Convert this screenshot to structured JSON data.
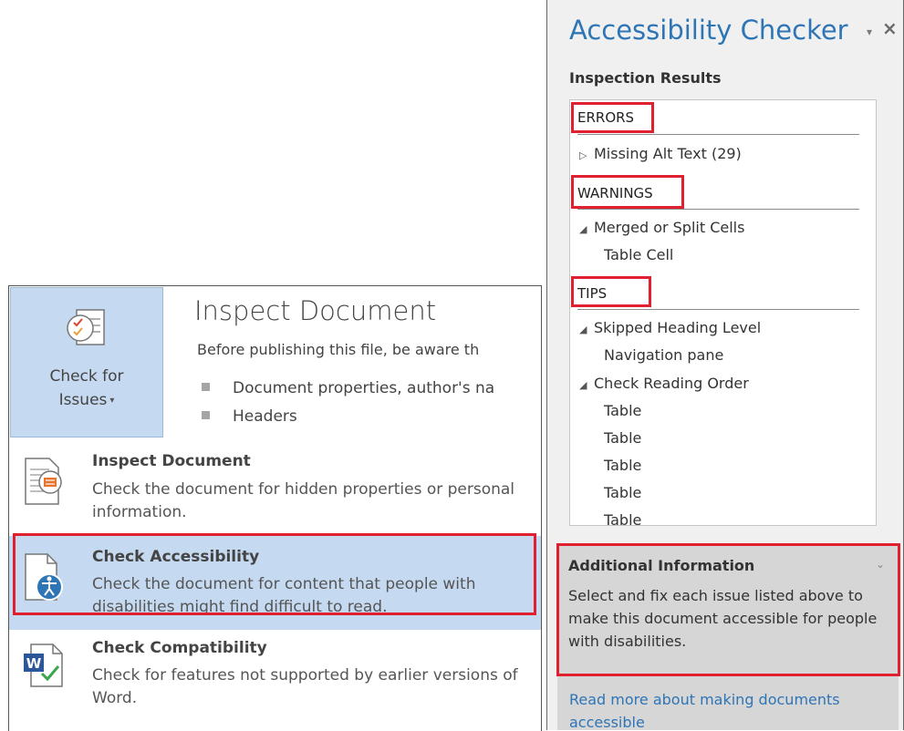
{
  "backstage": {
    "check_button": {
      "line1": "Check for",
      "line2": "Issues"
    },
    "inspect_heading": "Inspect Document",
    "inspect_description": "Before publishing this file, be aware th",
    "bullets": [
      "Document properties, author's na",
      "Headers"
    ]
  },
  "menu": {
    "items": [
      {
        "title": "Inspect Document",
        "description": "Check the document for hidden properties or personal information."
      },
      {
        "title": "Check Accessibility",
        "description": "Check the document for content that people with disabilities might find difficult to read."
      },
      {
        "title": "Check Compatibility",
        "description": "Check for features not supported by earlier versions of Word."
      }
    ]
  },
  "pane": {
    "title": "Accessibility Checker",
    "dropdown_glyph": "▾",
    "close_glyph": "×",
    "inspection_label": "Inspection Results",
    "errors_label": "ERRORS",
    "errors_items": [
      "Missing Alt Text (29)"
    ],
    "warnings_label": "WARNINGS",
    "warnings_items": [
      "Merged or Split Cells",
      "Table Cell"
    ],
    "tips_label": "TIPS",
    "tips_items": [
      "Skipped Heading Level",
      "Navigation pane",
      "Check Reading Order",
      "Table",
      "Table",
      "Table",
      "Table",
      "Table"
    ],
    "additional_info_title": "Additional Information",
    "additional_info_text": "Select and fix each issue listed above to make this document accessible for people with disabilities.",
    "read_more_link": "Read more about making documents accessible"
  },
  "colors": {
    "accent_blue": "#2e75b6",
    "highlight_blue": "#c5d9f0",
    "annotation_red": "#e0202e"
  }
}
